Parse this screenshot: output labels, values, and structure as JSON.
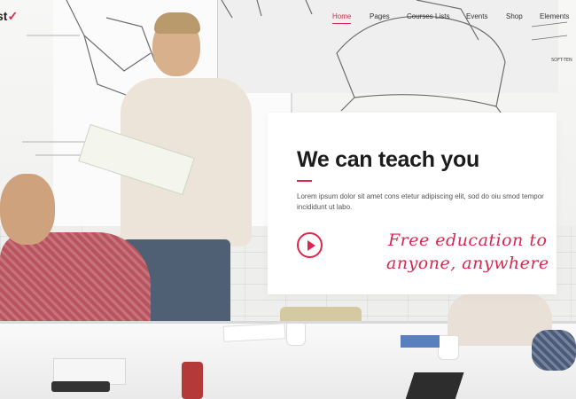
{
  "logo": {
    "text_main": "st",
    "text_accent": "✓"
  },
  "nav": {
    "items": [
      {
        "label": "Home",
        "active": true
      },
      {
        "label": "Pages",
        "active": false
      },
      {
        "label": "Courses Lists",
        "active": false
      },
      {
        "label": "Events",
        "active": false
      },
      {
        "label": "Shop",
        "active": false
      },
      {
        "label": "Elements",
        "active": false
      }
    ]
  },
  "board_label": "SOFT-TEN",
  "hero": {
    "title": "We can teach you",
    "text": "Lorem ipsum dolor sit amet cons etetur adipiscing elit, sod do oiu smod tempor incididunt ut labo.",
    "play_icon": "play-icon",
    "script_line_1": "Free education to",
    "script_line_2": "anyone, anywhere"
  },
  "colors": {
    "accent": "#e0264d",
    "heading": "#1c1c1c",
    "body_text": "#555555",
    "card_bg": "#ffffff"
  }
}
